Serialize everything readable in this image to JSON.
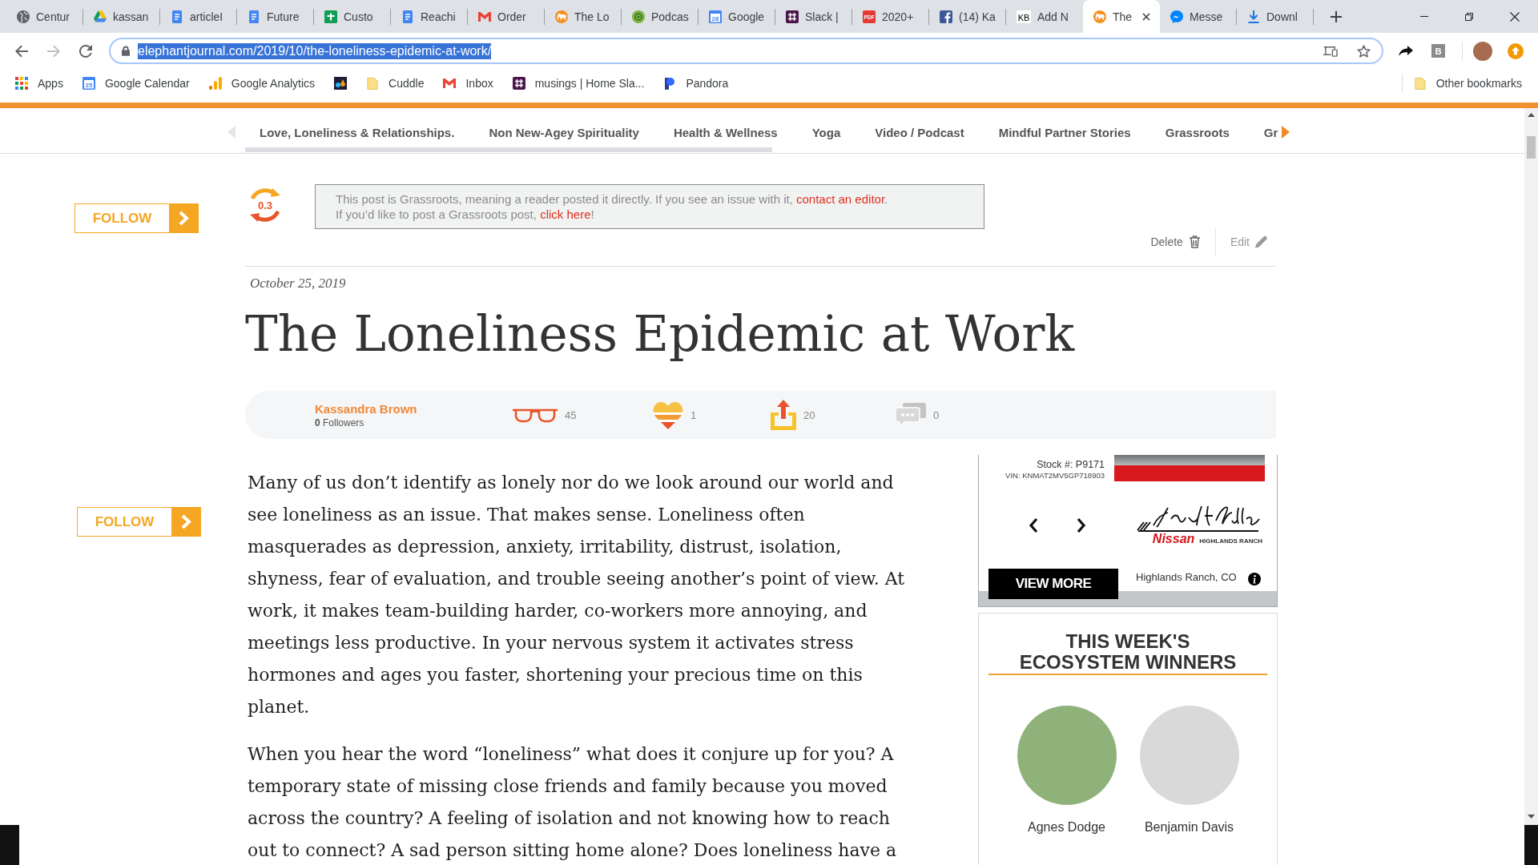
{
  "browser": {
    "tabs": [
      {
        "title": "Centur",
        "kind": "globe",
        "selected": false
      },
      {
        "title": "kassan",
        "kind": "drive",
        "selected": false
      },
      {
        "title": "articleI",
        "kind": "docs",
        "selected": false
      },
      {
        "title": "Future",
        "kind": "docs",
        "selected": false
      },
      {
        "title": "Custo",
        "kind": "sheets",
        "selected": false
      },
      {
        "title": "Reachi",
        "kind": "docs",
        "selected": false
      },
      {
        "title": "Order",
        "kind": "gmail",
        "selected": false
      },
      {
        "title": "The Lo",
        "kind": "elephant",
        "selected": false
      },
      {
        "title": "Podcas",
        "kind": "podcast",
        "selected": false
      },
      {
        "title": "Google",
        "kind": "calendar",
        "icon_text": "28",
        "selected": false
      },
      {
        "title": "Slack |",
        "kind": "slack",
        "selected": false
      },
      {
        "title": "2020+",
        "kind": "pdf",
        "icon_text": "PDF",
        "selected": false
      },
      {
        "title": "(14) Ka",
        "kind": "facebook",
        "selected": false
      },
      {
        "title": "Add N",
        "kind": "kb",
        "icon_text": "KB",
        "selected": false
      },
      {
        "title": "The",
        "kind": "elephant",
        "selected": true
      },
      {
        "title": "Messe",
        "kind": "messenger",
        "selected": false
      },
      {
        "title": "Downl",
        "kind": "download",
        "selected": false
      }
    ],
    "nav_buttons": [
      {
        "kind": "back",
        "disabled": false
      },
      {
        "kind": "forward",
        "disabled": true
      },
      {
        "kind": "reload",
        "disabled": false
      }
    ],
    "url": "elephantjournal.com/2019/10/the-loneliness-epidemic-at-work/",
    "url_selected": true,
    "extension_text": "B",
    "bookmarks": [
      {
        "label": "Apps",
        "kind": "apps"
      },
      {
        "label": "Google Calendar",
        "kind": "calendar",
        "icon_text": "25"
      },
      {
        "label": "Google Analytics",
        "kind": "analytics"
      },
      {
        "kind": "wu"
      },
      {
        "label": "Cuddle",
        "kind": "folder"
      },
      {
        "label": "Inbox",
        "kind": "gmail"
      },
      {
        "label": "musings | Home Sla...",
        "kind": "slack"
      },
      {
        "label": "Pandora",
        "kind": "pandora"
      }
    ],
    "other_bookmarks": "Other bookmarks"
  },
  "site_nav": {
    "items": [
      "Love, Loneliness & Relationships.",
      "Non New-Agey Spirituality",
      "Health & Wellness",
      "Yoga",
      "Video / Podcast",
      "Mindful Partner Stories",
      "Grassroots",
      "Gr"
    ],
    "arrows": [
      {
        "kind": "left",
        "disabled": true
      },
      {
        "kind": "right",
        "disabled": false
      }
    ]
  },
  "post": {
    "follow_buttons": [
      "FOLLOW",
      "FOLLOW"
    ],
    "score": "0.3",
    "notice": [
      {
        "text": "This post is Grassroots, meaning a reader posted it directly. If you see an issue with it, ",
        "link": "contact an editor",
        "after": "."
      },
      {
        "text": "If you’d like to post a Grassroots post, ",
        "link": "click here",
        "after": "!"
      }
    ],
    "actions": [
      {
        "label": "Delete",
        "kind": "delete"
      },
      {
        "label": "Edit",
        "kind": "edit"
      }
    ],
    "date": "October 25, 2019",
    "title": "The Loneliness Epidemic at Work",
    "author": {
      "name": "Kassandra Brown",
      "followers": "**0** Followers"
    },
    "stats": [
      {
        "kind": "reads",
        "count": "45"
      },
      {
        "kind": "hearts",
        "count": "1"
      },
      {
        "kind": "shares",
        "count": "20"
      },
      {
        "kind": "comments",
        "count": "0"
      }
    ],
    "paragraphs": [
      "Many of us don’t identify as lonely nor do we look around our world and see loneliness as an issue. That makes sense. Loneliness often masquerades as depression, anxiety, irritability, distrust, isolation, shyness, fear of evaluation, and trouble seeing another’s point of view. At work, it makes team-building harder, co-workers more annoying, and meetings less productive. In your nervous system it activates stress hormones and ages you faster, shortening your precious time on this planet.",
      "When you hear the word “loneliness” what does it conjure up for you? A temporary state of missing close friends and family because you moved across the country? A feeling of isolation and not knowing how to reach out to connect? A sad person sitting home alone? Does loneliness have a"
    ]
  },
  "sidebar": {
    "ad": {
      "stock": "Stock #: P9171",
      "vin": "VIN: KNMAT2MV5GP718903",
      "brand": "Nissan",
      "brand_place": "HIGHLANDS RANCH",
      "button": "VIEW MORE",
      "location": "Highlands Ranch, CO"
    },
    "winners": {
      "heading": "THIS WEEK'S ECOSYSTEM WINNERS",
      "people": [
        {
          "name": "Agnes Dodge"
        },
        {
          "name": "Benjamin Davis"
        }
      ]
    }
  }
}
